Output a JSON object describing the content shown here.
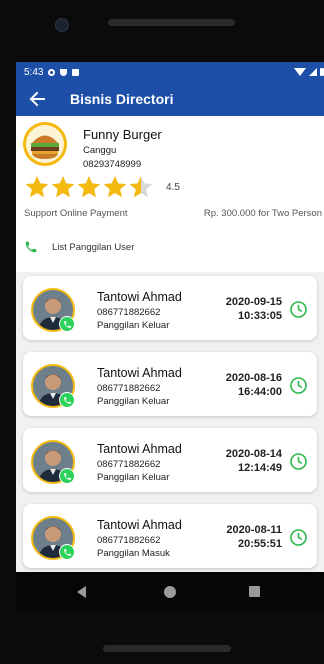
{
  "status_bar": {
    "time": "5:43"
  },
  "app_bar": {
    "title": "Bisnis Directori"
  },
  "shop": {
    "name": "Funny Burger",
    "city": "Canggu",
    "phone": "08293748999",
    "rating": 4.5,
    "rating_label": "4.5",
    "stars_max": 5,
    "support_text": "Support Online Payment",
    "price_text": "Rp. 300.000 for Two Person",
    "call_log_label": "List Panggilan User"
  },
  "colors": {
    "primary": "#1d4fa9",
    "star": "#f3b911",
    "green": "#2bb84a",
    "whatsapp": "#2bd35b"
  },
  "calls": [
    {
      "name": "Tantowi Ahmad",
      "phone": "086771882662",
      "type": "Panggilan Keluar",
      "date": "2020-09-15",
      "time": "10:33:05"
    },
    {
      "name": "Tantowi Ahmad",
      "phone": "086771882662",
      "type": "Panggilan Keluar",
      "date": "2020-08-16",
      "time": "16:44:00"
    },
    {
      "name": "Tantowi Ahmad",
      "phone": "086771882662",
      "type": "Panggilan Keluar",
      "date": "2020-08-14",
      "time": "12:14:49"
    },
    {
      "name": "Tantowi Ahmad",
      "phone": "086771882662",
      "type": "Panggilan Masuk",
      "date": "2020-08-11",
      "time": "20:55:51"
    }
  ]
}
